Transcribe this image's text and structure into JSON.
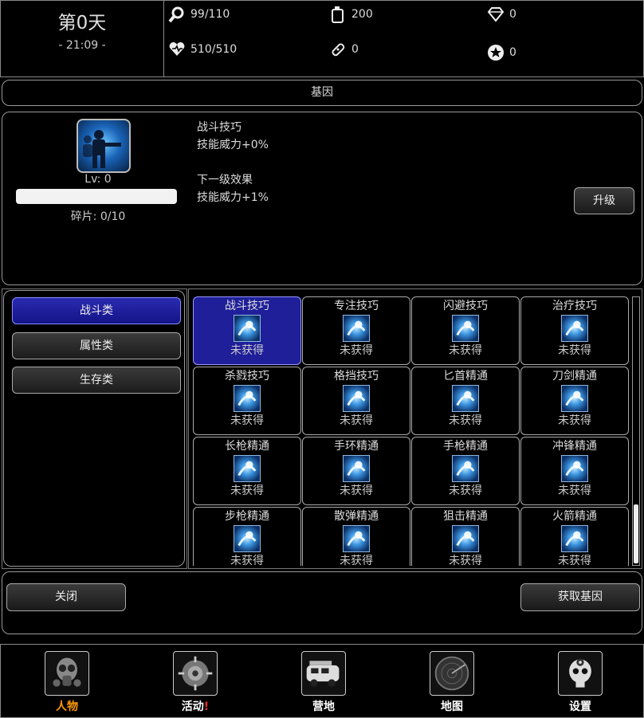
{
  "status": {
    "day": "第0天",
    "clock": "- 21:09 -",
    "stats": [
      {
        "icon": "search-icon",
        "value": "99/110"
      },
      {
        "icon": "fuel-can-icon",
        "value": "200"
      },
      {
        "icon": "diamond-icon",
        "value": "0"
      },
      {
        "icon": "heart-icon",
        "value": "510/510"
      },
      {
        "icon": "bandage-icon",
        "value": "0"
      },
      {
        "icon": "star-icon",
        "value": "0"
      }
    ]
  },
  "title": "基因",
  "detail": {
    "icon": "combat-soldier-icon",
    "level": "Lv: 0",
    "progress": 0,
    "shards": "碎片: 0/10",
    "name": "战斗技巧",
    "current_effect": "技能威力+0%",
    "next_title": "下一级效果",
    "next_effect": "技能威力+1%",
    "upgrade_label": "升级"
  },
  "categories": [
    {
      "label": "战斗类",
      "active": true
    },
    {
      "label": "属性类",
      "active": false
    },
    {
      "label": "生存类",
      "active": false
    }
  ],
  "skills": [
    {
      "name": "战斗技巧",
      "status": "未获得",
      "icon": "soldier-icon"
    },
    {
      "name": "专注技巧",
      "status": "未获得",
      "icon": "focus-icon"
    },
    {
      "name": "闪避技巧",
      "status": "未获得",
      "icon": "dodge-icon"
    },
    {
      "name": "治疗技巧",
      "status": "未获得",
      "icon": "heal-pulse-icon"
    },
    {
      "name": "杀戮技巧",
      "status": "未获得",
      "icon": "kill-icon"
    },
    {
      "name": "格挡技巧",
      "status": "未获得",
      "icon": "block-icon"
    },
    {
      "name": "匕首精通",
      "status": "未获得",
      "icon": "weapon-mastery-icon"
    },
    {
      "name": "刀剑精通",
      "status": "未获得",
      "icon": "weapon-mastery-icon"
    },
    {
      "name": "长枪精通",
      "status": "未获得",
      "icon": "weapon-mastery-icon"
    },
    {
      "name": "手环精通",
      "status": "未获得",
      "icon": "weapon-mastery-icon"
    },
    {
      "name": "手枪精通",
      "status": "未获得",
      "icon": "weapon-mastery-icon"
    },
    {
      "name": "冲锋精通",
      "status": "未获得",
      "icon": "weapon-mastery-icon"
    },
    {
      "name": "步枪精通",
      "status": "未获得",
      "icon": "weapon-mastery-icon"
    },
    {
      "name": "散弹精通",
      "status": "未获得",
      "icon": "weapon-mastery-icon"
    },
    {
      "name": "狙击精通",
      "status": "未获得",
      "icon": "weapon-mastery-icon"
    },
    {
      "name": "火箭精通",
      "status": "未获得",
      "icon": "weapon-mastery-icon"
    }
  ],
  "actions": {
    "close_label": "关闭",
    "get_label": "获取基因"
  },
  "nav": [
    {
      "label": "人物",
      "icon": "gas-mask-icon",
      "highlight": true,
      "alert": ""
    },
    {
      "label": "活动",
      "icon": "mechanism-icon",
      "highlight": false,
      "alert": "!"
    },
    {
      "label": "营地",
      "icon": "camper-van-icon",
      "highlight": false,
      "alert": ""
    },
    {
      "label": "地图",
      "icon": "radar-icon",
      "highlight": false,
      "alert": ""
    },
    {
      "label": "设置",
      "icon": "skull-gear-icon",
      "highlight": false,
      "alert": ""
    }
  ],
  "colors": {
    "active_category": "#1e1e9c",
    "active_nav_label": "#ff9900",
    "alert": "#ff2a2a"
  }
}
